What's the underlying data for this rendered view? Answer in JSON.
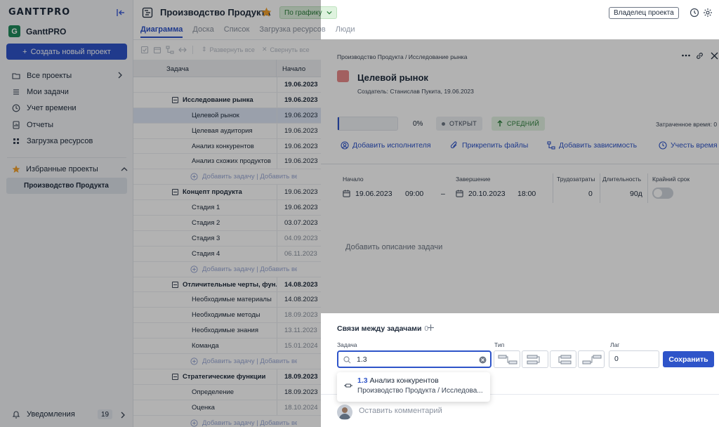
{
  "sidebar": {
    "brand": "GANTTPRO",
    "workspace": "GanttPRO",
    "workspace_initial": "G",
    "create_button": "Создать новый проект",
    "nav": [
      {
        "label": "Все проекты",
        "icon": "folder-icon"
      },
      {
        "label": "Мои задачи",
        "icon": "list-icon"
      },
      {
        "label": "Учет времени",
        "icon": "clock-icon"
      },
      {
        "label": "Отчеты",
        "icon": "report-icon"
      },
      {
        "label": "Загрузка ресурсов",
        "icon": "resources-icon"
      }
    ],
    "favorites_label": "Избранные проекты",
    "favorite_project": "Производство Продукта",
    "notifications_label": "Уведомления",
    "notifications_count": "19"
  },
  "header": {
    "project_title": "Производство Продукта",
    "status": "По графику",
    "owner_button": "Владелец проекта",
    "tabs": [
      "Диаграмма",
      "Доска",
      "Список",
      "Загрузка ресурсов",
      "Люди"
    ]
  },
  "toolbar": {
    "expand_all": "Развернуть все",
    "collapse_all": "Свернуть все"
  },
  "table": {
    "col_task": "Задача",
    "col_start": "Начало",
    "add_task": "Добавить задачу",
    "add_milestone": "Добавить веху",
    "rows": [
      {
        "name": "",
        "date": "19.06.2023"
      },
      {
        "name": "Исследование рынка",
        "date": "19.06.2023"
      },
      {
        "name": "Целевой рынок",
        "date": "19.06.2023"
      },
      {
        "name": "Целевая аудитория",
        "date": "19.06.2023"
      },
      {
        "name": "Анализ конкурентов",
        "date": "19.06.2023"
      },
      {
        "name": "Анализ схожих продуктов",
        "date": "19.06.2023"
      },
      {
        "name": "Концепт продукта",
        "date": "19.06.2023"
      },
      {
        "name": "Стадия 1",
        "date": "19.06.2023"
      },
      {
        "name": "Стадия 2",
        "date": "03.07.2023"
      },
      {
        "name": "Стадия 3",
        "date": "04.09.2023"
      },
      {
        "name": "Стадия 4",
        "date": "06.11.2023"
      },
      {
        "name": "Отличительные черты, фун...",
        "date": "14.08.2023"
      },
      {
        "name": "Необходимые материалы",
        "date": "14.08.2023"
      },
      {
        "name": "Необходимые методы",
        "date": "18.09.2023"
      },
      {
        "name": "Необходимые знания",
        "date": "13.11.2023"
      },
      {
        "name": "Команда",
        "date": "15.01.2024"
      },
      {
        "name": "Стратегические функции",
        "date": "18.09.2023"
      },
      {
        "name": "Определение",
        "date": "18.09.2023"
      },
      {
        "name": "Оценка",
        "date": "18.10.2024"
      }
    ]
  },
  "task": {
    "breadcrumb": "Производство Продукта / Исследование рынка",
    "title": "Целевой рынок",
    "creator": "Создатель: Станислав Пукита, 19.06.2023",
    "color": "#e88a8a",
    "progress_value": 0,
    "progress_text": "0%",
    "status": "ОТКРЫТ",
    "priority": "СРЕДНИЙ",
    "time_spent_label": "Затраченное время: 0",
    "actions": [
      "Добавить исполнителя",
      "Прикрепить файлы",
      "Добавить зависимость",
      "Учесть время"
    ],
    "start_label": "Начало",
    "start_date": "19.06.2023",
    "start_time": "09:00",
    "dash": "–",
    "end_label": "Завершение",
    "end_date": "20.10.2023",
    "end_time": "18:00",
    "effort_label": "Трудозатраты",
    "effort_value": "0",
    "duration_label": "Длительность",
    "duration_value": "90д",
    "deadline_label": "Крайний срок",
    "description_placeholder": "Добавить описание задачи",
    "dependencies_title": "Связи между задачами",
    "dependencies_count": "0",
    "field_task": "Задача",
    "field_type": "Тип",
    "field_lag": "Лаг",
    "task_search_value": "1.3",
    "lag_value": "0",
    "save_button": "Сохранить",
    "suggestion_num": "1.3",
    "suggestion_name": "Анализ конкурентов",
    "suggestion_path": "Производство Продукта / Исследова...",
    "comment_placeholder": "Оставить комментарий"
  }
}
